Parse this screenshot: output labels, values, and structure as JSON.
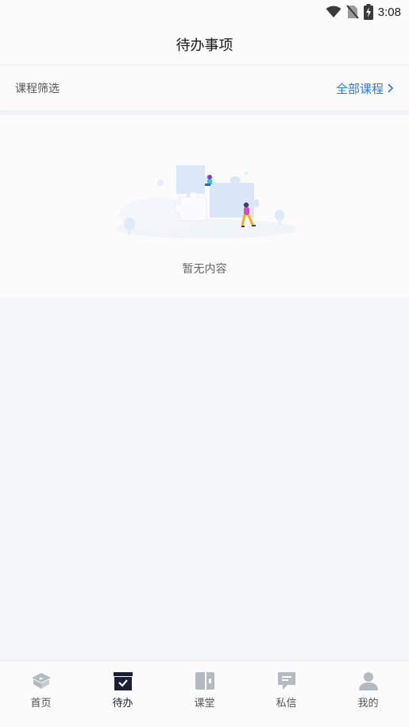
{
  "status_bar": {
    "time": "3:08"
  },
  "header": {
    "title": "待办事项"
  },
  "filter": {
    "label": "课程筛选",
    "selected": "全部课程"
  },
  "empty_state": {
    "message": "暂无内容"
  },
  "tabbar": {
    "tabs": [
      {
        "label": "首页",
        "icon": "home-book-icon",
        "active": false
      },
      {
        "label": "待办",
        "icon": "todo-check-icon",
        "active": true
      },
      {
        "label": "课堂",
        "icon": "classroom-icon",
        "active": false
      },
      {
        "label": "私信",
        "icon": "message-icon",
        "active": false
      },
      {
        "label": "我的",
        "icon": "profile-icon",
        "active": false
      }
    ]
  },
  "colors": {
    "accent": "#2a7ae2",
    "active_tab": "#1a1f33",
    "inactive_tab": "#b5bac1"
  }
}
